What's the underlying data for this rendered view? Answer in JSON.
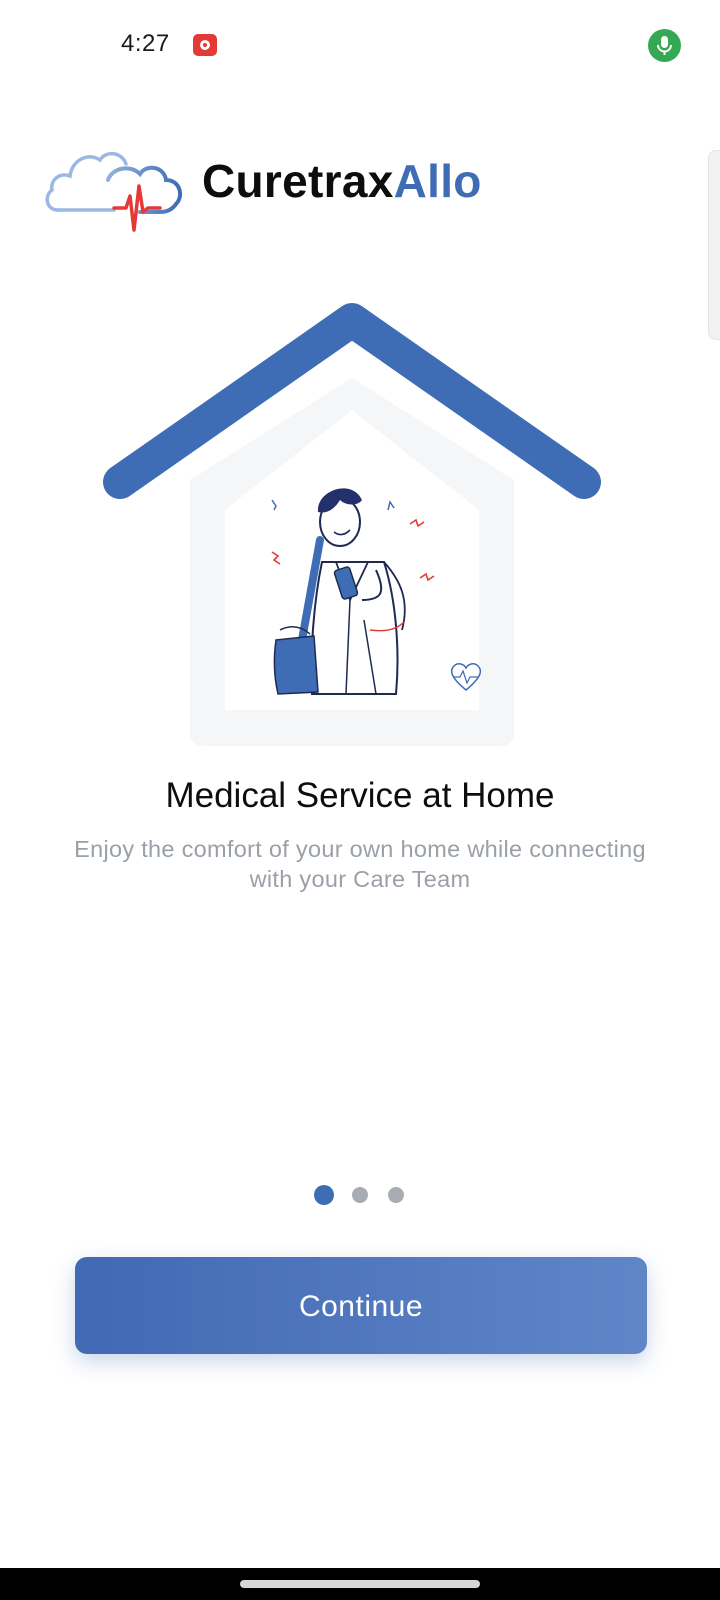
{
  "status_bar": {
    "time": "4:27",
    "icons": [
      "screen-record-icon",
      "microphone-icon"
    ]
  },
  "brand": {
    "name_primary": "Curetrax",
    "name_accent": "Allo",
    "accent_color": "#3f6db5"
  },
  "onboarding": {
    "title": "Medical Service at Home",
    "subtitle": "Enjoy the comfort of your own home while connecting with your Care Team",
    "page_index": 1,
    "page_count": 3
  },
  "actions": {
    "continue_label": "Continue"
  },
  "colors": {
    "primary": "#3f6db5",
    "dot_inactive": "#a7acb3",
    "subtitle": "#9aa0a8",
    "recording": "#e53935",
    "mic": "#34a853"
  }
}
